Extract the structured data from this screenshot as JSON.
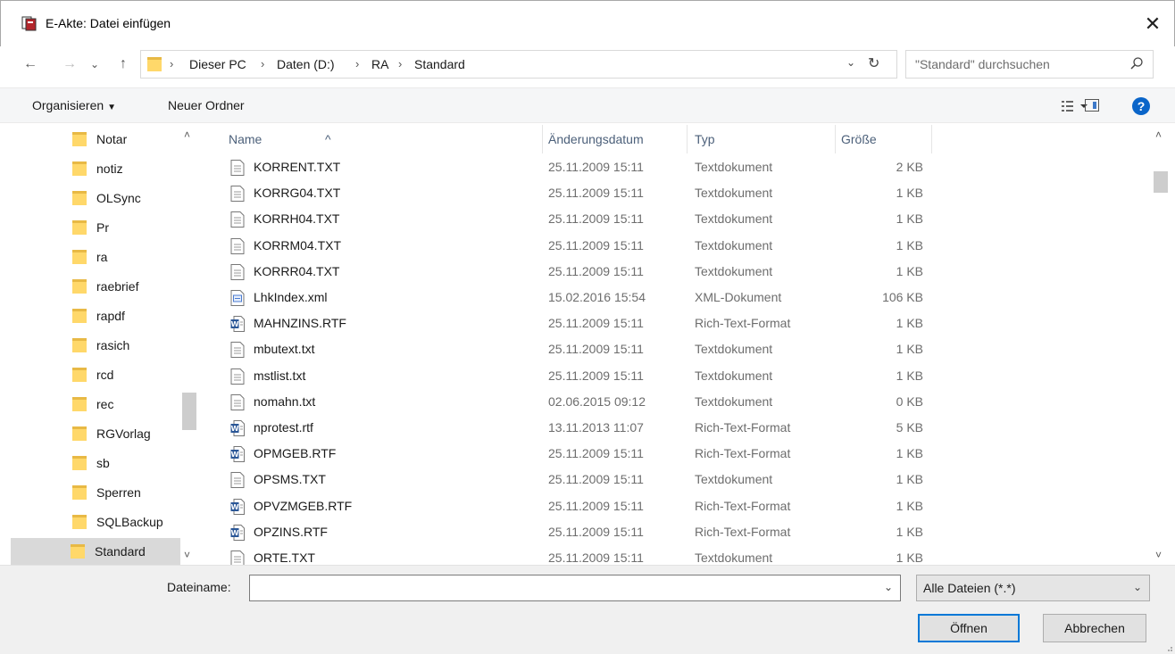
{
  "window": {
    "title": "E-Akte: Datei einfügen",
    "close_glyph": "✕"
  },
  "nav": {
    "back_glyph": "←",
    "forward_glyph": "→",
    "history_glyph": "⌄",
    "up_glyph": "↑",
    "breadcrumbs": [
      "Dieser PC",
      "Daten (D:)",
      "RA",
      "Standard"
    ],
    "separator": "›",
    "dropdown_glyph": "⌄",
    "refresh_glyph": "↻"
  },
  "search": {
    "placeholder": "\"Standard\" durchsuchen"
  },
  "toolbar": {
    "organize": "Organisieren",
    "organize_caret": "▼",
    "new_folder": "Neuer Ordner",
    "help": "?"
  },
  "tree": {
    "items": [
      "Notar",
      "notiz",
      "OLSync",
      "Pr",
      "ra",
      "raebrief",
      "rapdf",
      "rasich",
      "rcd",
      "rec",
      "RGVorlag",
      "sb",
      "Sperren",
      "SQLBackup",
      "Standard"
    ],
    "selected": "Standard"
  },
  "columns": {
    "name": "Name",
    "date": "Änderungsdatum",
    "type": "Typ",
    "size": "Größe",
    "sort_glyph": "^"
  },
  "files": [
    {
      "name": "KORRENT.TXT",
      "date": "25.11.2009 15:11",
      "type": "Textdokument",
      "size": "2 KB",
      "icon": "text"
    },
    {
      "name": "KORRG04.TXT",
      "date": "25.11.2009 15:11",
      "type": "Textdokument",
      "size": "1 KB",
      "icon": "text"
    },
    {
      "name": "KORRH04.TXT",
      "date": "25.11.2009 15:11",
      "type": "Textdokument",
      "size": "1 KB",
      "icon": "text"
    },
    {
      "name": "KORRM04.TXT",
      "date": "25.11.2009 15:11",
      "type": "Textdokument",
      "size": "1 KB",
      "icon": "text"
    },
    {
      "name": "KORRR04.TXT",
      "date": "25.11.2009 15:11",
      "type": "Textdokument",
      "size": "1 KB",
      "icon": "text"
    },
    {
      "name": "LhkIndex.xml",
      "date": "15.02.2016 15:54",
      "type": "XML-Dokument",
      "size": "106 KB",
      "icon": "xml"
    },
    {
      "name": "MAHNZINS.RTF",
      "date": "25.11.2009 15:11",
      "type": "Rich-Text-Format",
      "size": "1 KB",
      "icon": "word"
    },
    {
      "name": "mbutext.txt",
      "date": "25.11.2009 15:11",
      "type": "Textdokument",
      "size": "1 KB",
      "icon": "text"
    },
    {
      "name": "mstlist.txt",
      "date": "25.11.2009 15:11",
      "type": "Textdokument",
      "size": "1 KB",
      "icon": "text"
    },
    {
      "name": "nomahn.txt",
      "date": "02.06.2015 09:12",
      "type": "Textdokument",
      "size": "0 KB",
      "icon": "text"
    },
    {
      "name": "nprotest.rtf",
      "date": "13.11.2013 11:07",
      "type": "Rich-Text-Format",
      "size": "5 KB",
      "icon": "word"
    },
    {
      "name": "OPMGEB.RTF",
      "date": "25.11.2009 15:11",
      "type": "Rich-Text-Format",
      "size": "1 KB",
      "icon": "word"
    },
    {
      "name": "OPSMS.TXT",
      "date": "25.11.2009 15:11",
      "type": "Textdokument",
      "size": "1 KB",
      "icon": "text"
    },
    {
      "name": "OPVZMGEB.RTF",
      "date": "25.11.2009 15:11",
      "type": "Rich-Text-Format",
      "size": "1 KB",
      "icon": "word"
    },
    {
      "name": "OPZINS.RTF",
      "date": "25.11.2009 15:11",
      "type": "Rich-Text-Format",
      "size": "1 KB",
      "icon": "word"
    },
    {
      "name": "ORTE.TXT",
      "date": "25.11.2009 15:11",
      "type": "Textdokument",
      "size": "1 KB",
      "icon": "text"
    }
  ],
  "scroll": {
    "up_glyph": "˄",
    "down_glyph": "˅"
  },
  "footer": {
    "filename_label": "Dateiname:",
    "filename_value": "",
    "filter_value": "Alle Dateien (*.*)",
    "open_label": "Öffnen",
    "cancel_label": "Abbrechen",
    "dropdown_glyph": "⌄"
  },
  "colors": {
    "accent": "#0078d7",
    "folder": "#ffd86a",
    "help": "#0a65c9"
  }
}
